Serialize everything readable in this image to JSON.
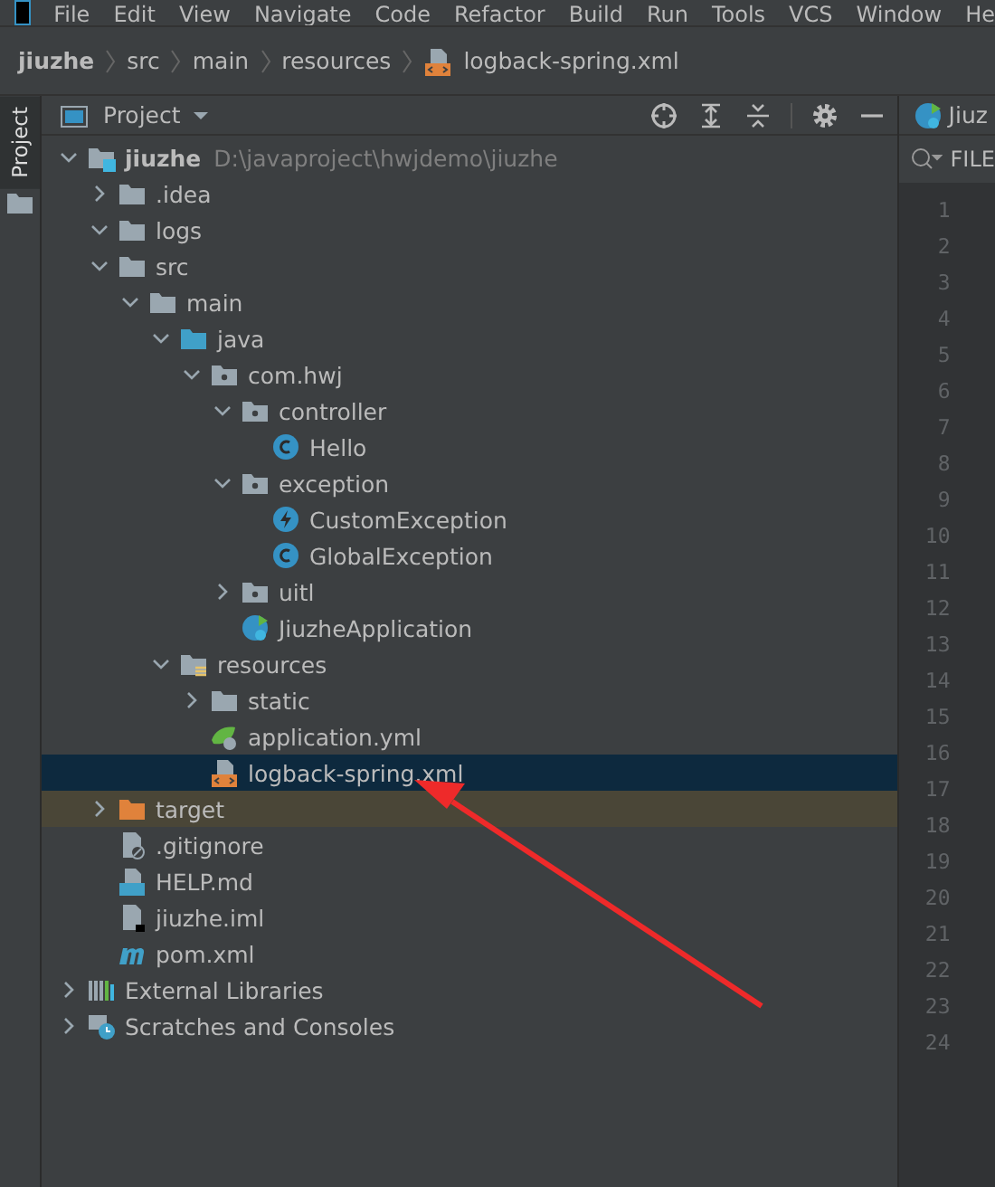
{
  "menu": [
    "File",
    "Edit",
    "View",
    "Navigate",
    "Code",
    "Refactor",
    "Build",
    "Run",
    "Tools",
    "VCS",
    "Window",
    "He"
  ],
  "breadcrumbs": [
    {
      "label": "jiuzhe",
      "kind": "project"
    },
    {
      "label": "src",
      "kind": "folder"
    },
    {
      "label": "main",
      "kind": "folder"
    },
    {
      "label": "resources",
      "kind": "folder"
    },
    {
      "label": "logback-spring.xml",
      "kind": "xml"
    }
  ],
  "side_tab": {
    "label": "Project",
    "selected": true
  },
  "tool_window": {
    "title": "Project"
  },
  "tree": [
    {
      "name": "jiuzhe",
      "hint": "D:\\javaproject\\hwjdemo\\jiuzhe",
      "kind": "module",
      "expanded": true,
      "selected": false,
      "excluded": false,
      "children": [
        {
          "name": ".idea",
          "kind": "folder",
          "expanded": false,
          "selected": false,
          "excluded": false
        },
        {
          "name": "logs",
          "kind": "folder",
          "expanded": true,
          "selected": false,
          "excluded": false
        },
        {
          "name": "src",
          "kind": "folder",
          "expanded": true,
          "selected": false,
          "excluded": false,
          "children": [
            {
              "name": "main",
              "kind": "folder",
              "expanded": true,
              "selected": false,
              "excluded": false,
              "children": [
                {
                  "name": "java",
                  "kind": "source",
                  "expanded": true,
                  "selected": false,
                  "excluded": false,
                  "children": [
                    {
                      "name": "com.hwj",
                      "kind": "package",
                      "expanded": true,
                      "selected": false,
                      "excluded": false,
                      "children": [
                        {
                          "name": "controller",
                          "kind": "package",
                          "expanded": true,
                          "selected": false,
                          "excluded": false,
                          "children": [
                            {
                              "name": "Hello",
                              "kind": "class",
                              "selected": false,
                              "excluded": false
                            }
                          ]
                        },
                        {
                          "name": "exception",
                          "kind": "package",
                          "expanded": true,
                          "selected": false,
                          "excluded": false,
                          "children": [
                            {
                              "name": "CustomException",
                              "kind": "exception",
                              "selected": false,
                              "excluded": false
                            },
                            {
                              "name": "GlobalException",
                              "kind": "class",
                              "selected": false,
                              "excluded": false
                            }
                          ]
                        },
                        {
                          "name": "uitl",
                          "kind": "package",
                          "expanded": false,
                          "selected": false,
                          "excluded": false
                        },
                        {
                          "name": "JiuzheApplication",
                          "kind": "app",
                          "selected": false,
                          "excluded": false
                        }
                      ]
                    }
                  ]
                },
                {
                  "name": "resources",
                  "kind": "resources",
                  "expanded": true,
                  "selected": false,
                  "excluded": false,
                  "children": [
                    {
                      "name": "static",
                      "kind": "folder",
                      "expanded": false,
                      "selected": false,
                      "excluded": false
                    },
                    {
                      "name": "application.yml",
                      "kind": "yml",
                      "selected": false,
                      "excluded": false
                    },
                    {
                      "name": "logback-spring.xml",
                      "kind": "xml",
                      "selected": true,
                      "excluded": false
                    }
                  ]
                }
              ]
            }
          ]
        },
        {
          "name": "target",
          "kind": "excluded",
          "expanded": false,
          "selected": false,
          "excluded": true
        },
        {
          "name": ".gitignore",
          "kind": "ignore",
          "selected": false,
          "excluded": false
        },
        {
          "name": "HELP.md",
          "kind": "md",
          "selected": false,
          "excluded": false
        },
        {
          "name": "jiuzhe.iml",
          "kind": "iml",
          "selected": false,
          "excluded": false
        },
        {
          "name": "pom.xml",
          "kind": "maven",
          "selected": false,
          "excluded": false
        }
      ]
    },
    {
      "name": "External Libraries",
      "kind": "libraries",
      "expanded": false,
      "selected": false,
      "excluded": false
    },
    {
      "name": "Scratches and Consoles",
      "kind": "scratches",
      "expanded": false,
      "selected": false,
      "excluded": false
    }
  ],
  "editor": {
    "tab": "Jiuz",
    "filter": "FILE",
    "line_numbers": [
      "1",
      "2",
      "3",
      "4",
      "5",
      "6",
      "7",
      "8",
      "9",
      "10",
      "11",
      "12",
      "13",
      "14",
      "15",
      "16",
      "17",
      "18",
      "19",
      "20",
      "21",
      "22",
      "23",
      "24"
    ]
  }
}
